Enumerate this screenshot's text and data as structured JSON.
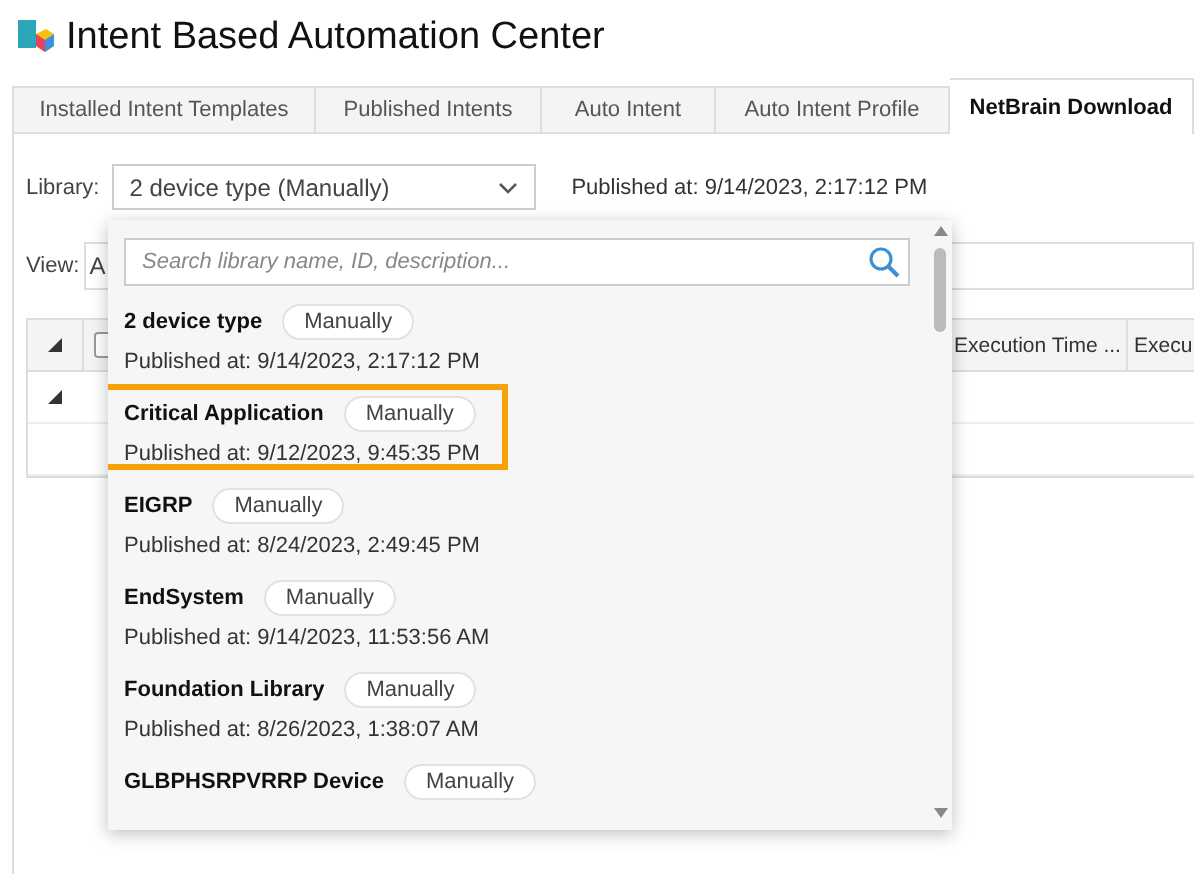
{
  "window": {
    "title": "Intent Based Automation Center"
  },
  "tabs": [
    {
      "label": "Installed Intent Templates",
      "selected": false
    },
    {
      "label": "Published Intents",
      "selected": false
    },
    {
      "label": "Auto Intent",
      "selected": false
    },
    {
      "label": "Auto Intent Profile",
      "selected": false
    },
    {
      "label": "NetBrain Download",
      "selected": true
    }
  ],
  "library": {
    "label": "Library:",
    "value": "2 device type (Manually)",
    "published": "Published at: 9/14/2023, 2:17:12 PM"
  },
  "view": {
    "label": "View:",
    "value": "A"
  },
  "table": {
    "select_all": {
      "checked": false
    },
    "columns": [
      {
        "label": "Execution Time ..."
      },
      {
        "label": "Execu"
      }
    ]
  },
  "dropdown": {
    "search": {
      "placeholder": "Search library name, ID, description..."
    },
    "items": [
      {
        "name": "2 device type",
        "badge": "Manually",
        "published": "Published at: 9/14/2023, 2:17:12 PM",
        "highlighted": false
      },
      {
        "name": "Critical Application",
        "badge": "Manually",
        "published": "Published at: 9/12/2023, 9:45:35 PM",
        "highlighted": true
      },
      {
        "name": "EIGRP",
        "badge": "Manually",
        "published": "Published at: 8/24/2023, 2:49:45 PM",
        "highlighted": false
      },
      {
        "name": "EndSystem",
        "badge": "Manually",
        "published": "Published at: 9/14/2023, 11:53:56 AM",
        "highlighted": false
      },
      {
        "name": "Foundation Library",
        "badge": "Manually",
        "published": "Published at: 8/26/2023, 1:38:07 AM",
        "highlighted": false
      },
      {
        "name": "GLBPHSRPVRRP Device",
        "badge": "Manually",
        "highlighted": false
      }
    ]
  }
}
